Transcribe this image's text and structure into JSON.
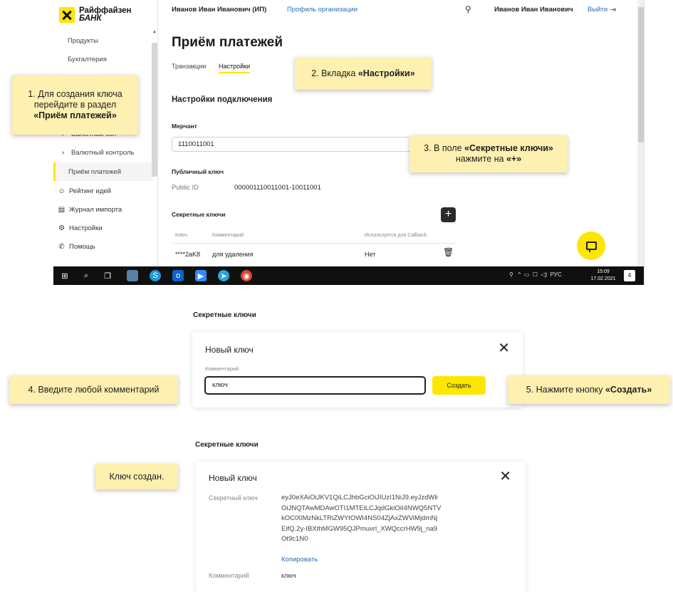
{
  "app": {
    "logo": {
      "line1": "Райффайзен",
      "line2": "БАНК"
    },
    "sidebar": {
      "items": [
        {
          "label": "Продукты"
        },
        {
          "label": "Бухгалтерия"
        },
        {
          "label": "Валютный кон"
        },
        {
          "label": "Валютный контроль"
        },
        {
          "label": "Приём платежей"
        },
        {
          "label": "Рейтинг идей"
        },
        {
          "label": "Журнал импорта"
        },
        {
          "label": "Настройки"
        },
        {
          "label": "Помощь"
        }
      ]
    },
    "topbar": {
      "org_user": "Иванов Иван Иванович (ИП)",
      "profile_link": "Профиль организации",
      "username": "Иванов Иван Иванович",
      "logout": "Выйти"
    },
    "page_title": "Приём платежей",
    "tabs": [
      {
        "label": "Транзакции"
      },
      {
        "label": "Настройки"
      }
    ],
    "connection_title": "Настройки подключения",
    "merchant": {
      "label": "Мерчант",
      "value": "1110011001"
    },
    "public_key": {
      "label": "Публичный ключ",
      "id_label": "Public ID",
      "id_value": "000001110011001-10011001"
    },
    "secret_keys": {
      "label": "Секретные ключи",
      "add_button": "+",
      "columns": [
        "Ключ",
        "Комментарий",
        "Используется для Callback"
      ],
      "rows": [
        {
          "key": "****2aK8",
          "comment": "для удаления",
          "callback": "Нет"
        }
      ]
    },
    "taskbar": {
      "time": "15:09",
      "date": "17.02.2021",
      "lang": "РУС",
      "notify_count": "4"
    }
  },
  "callouts": {
    "c1_line1": "1. Для создания ключа",
    "c1_line2": "перейдите в раздел",
    "c1_line3": "«Приём платежей»",
    "c2_prefix": "2. Вкладка ",
    "c2_bold": "«Настройки»",
    "c3_prefix": "3. В поле ",
    "c3_bold": "«Секретные ключи»",
    "c3_line2_prefix": "нажмите на ",
    "c3_line2_bold": "«+»",
    "c4": "4. Введите любой комментарий",
    "c5_prefix": "5. Нажмите кнопку ",
    "c5_bold": "«Создать»",
    "c6": "Ключ создан."
  },
  "panel2": {
    "section_title": "Секретные ключи",
    "heading": "Новый ключ",
    "comment_label": "Комментарий",
    "comment_value": "ключ",
    "create_button": "Создать"
  },
  "panel3": {
    "section_title": "Секретные ключи",
    "heading": "Новый ключ",
    "secret_label": "Секретный ключ",
    "secret_lines": [
      "eyJ0eXAiOiJKV1QiLCJhbGciOiJIUzI1NiJ9.eyJzdWli",
      "OiJNQTAwMDAwOTI1MTEiLCJqdGkiOiI4NWQ5NTV",
      "kOC00MzNkLTRiZWYtOWI4NS04ZjAxZWViMjdmNj",
      "EifQ.2y-IBXthMGW95QJPmuvrl_XWQccrHW9j_na9",
      "Ot9c1N0"
    ],
    "copy_link": "Копировать",
    "comment_label": "Комментарий",
    "comment_value": "ключ"
  }
}
